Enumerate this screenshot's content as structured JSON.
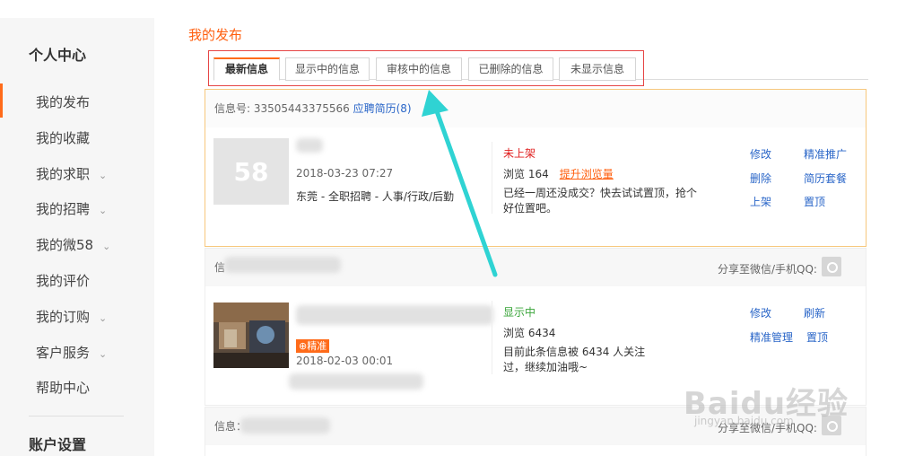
{
  "sidebar": {
    "heading": "个人中心",
    "items": [
      {
        "label": "我的发布",
        "chevron": ""
      },
      {
        "label": "我的收藏",
        "chevron": ""
      },
      {
        "label": "我的求职",
        "chevron": "⌄"
      },
      {
        "label": "我的招聘",
        "chevron": "⌄"
      },
      {
        "label": "我的微58",
        "chevron": "⌄"
      },
      {
        "label": "我的评价",
        "chevron": ""
      },
      {
        "label": "我的订购",
        "chevron": "⌄"
      },
      {
        "label": "客户服务",
        "chevron": "⌄"
      },
      {
        "label": "帮助中心",
        "chevron": ""
      }
    ],
    "footer_heading": "账户设置"
  },
  "page_title": "我的发布",
  "tabs": [
    "最新信息",
    "显示中的信息",
    "审核中的信息",
    "已删除的信息",
    "未显示信息"
  ],
  "cards": [
    {
      "header_prefix": "信息号: 33505443375566",
      "header_link": "应聘简历(8)",
      "thumb_text": "58",
      "date": "2018-03-23 07:27",
      "category": "东莞 - 全职招聘 - 人事/行政/后勤",
      "status": "未上架",
      "status_color": "#e02020",
      "views": "浏览 164",
      "promo": "提升浏览量",
      "tip": "已经一周还没成交？快去试试置顶，抢个好位置吧。",
      "actions": [
        "修改",
        "精准推广",
        "删除",
        "简历套餐",
        "上架",
        "置顶"
      ]
    },
    {
      "header_prefix": "信",
      "share_label": "分享至微信/手机QQ:",
      "badge": "精准",
      "date": "2018-02-03 00:01",
      "status": "显示中",
      "status_color": "#3aa53a",
      "views": "浏览 6434",
      "tip": "目前此条信息被 6434 人关注过，继续加油哦~",
      "actions": [
        "修改",
        "刷新",
        "精准管理",
        "置顶"
      ]
    },
    {
      "header_prefix": "信息：",
      "share_label": "分享至微信/手机QQ:"
    }
  ],
  "watermark": {
    "main": "Baidu经验",
    "sub": "jingyan.baidu.com"
  },
  "colors": {
    "accent": "#ff6b1a",
    "link": "#2a66c8",
    "highlight_box": "#e64545",
    "arrow": "#2fd3d3"
  }
}
